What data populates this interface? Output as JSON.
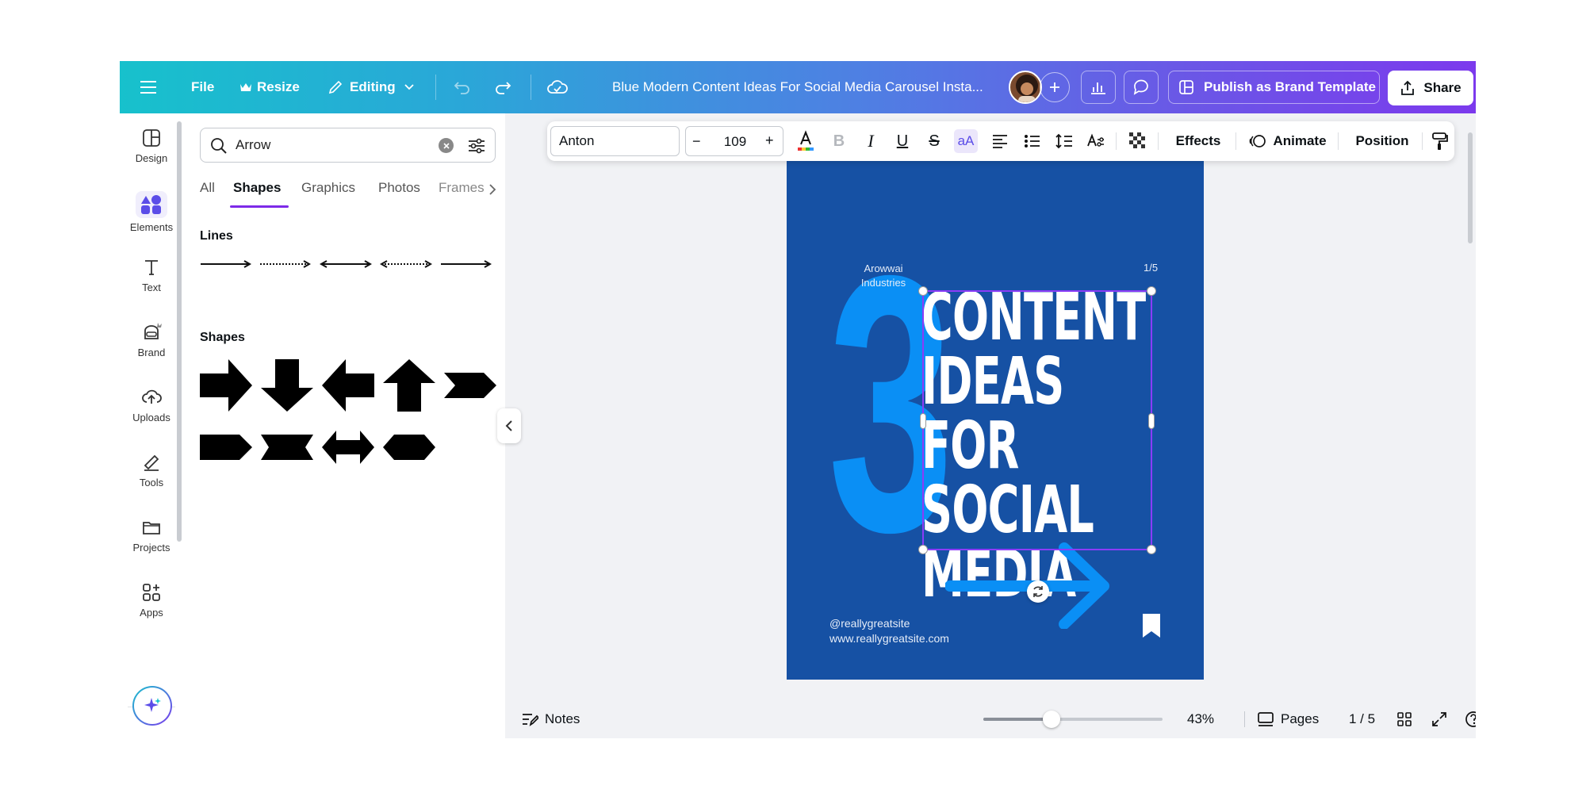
{
  "topbar": {
    "file_label": "File",
    "resize_label": "Resize",
    "editing_label": "Editing",
    "doc_title": "Blue Modern Content Ideas For Social Media Carousel Insta...",
    "publish_label": "Publish as Brand Template",
    "share_label": "Share"
  },
  "rail": {
    "items": [
      {
        "label": "Design",
        "icon": "design-icon"
      },
      {
        "label": "Elements",
        "icon": "elements-icon"
      },
      {
        "label": "Text",
        "icon": "text-icon"
      },
      {
        "label": "Brand",
        "icon": "brand-icon"
      },
      {
        "label": "Uploads",
        "icon": "uploads-icon"
      },
      {
        "label": "Tools",
        "icon": "tools-icon"
      },
      {
        "label": "Projects",
        "icon": "projects-icon"
      },
      {
        "label": "Apps",
        "icon": "apps-icon"
      }
    ]
  },
  "panel": {
    "search_value": "Arrow",
    "tabs": [
      {
        "label": "All"
      },
      {
        "label": "Shapes"
      },
      {
        "label": "Graphics"
      },
      {
        "label": "Photos"
      },
      {
        "label": "Frames"
      }
    ],
    "lines_title": "Lines",
    "shapes_title": "Shapes"
  },
  "toolbar": {
    "font_name": "Anton",
    "font_size": "109",
    "minus": "−",
    "plus": "+",
    "case_label": "aA",
    "effects_label": "Effects",
    "animate_label": "Animate",
    "position_label": "Position"
  },
  "canvas": {
    "brand_name": "Arowwai\nIndustries",
    "page_counter": "1/5",
    "big_number": "3",
    "headline": "CONTENT\nIDEAS FOR\nSOCIAL\nMEDIA",
    "handle": "@reallygreatsite",
    "website": "www.reallygreatsite.com",
    "page_color": "#1651a4",
    "accent_color": "#0a8ff5"
  },
  "bottombar": {
    "notes_label": "Notes",
    "zoom": "43%",
    "zoom_fraction": 0.38,
    "pages_label": "Pages",
    "page_indicator": "1 / 5"
  }
}
